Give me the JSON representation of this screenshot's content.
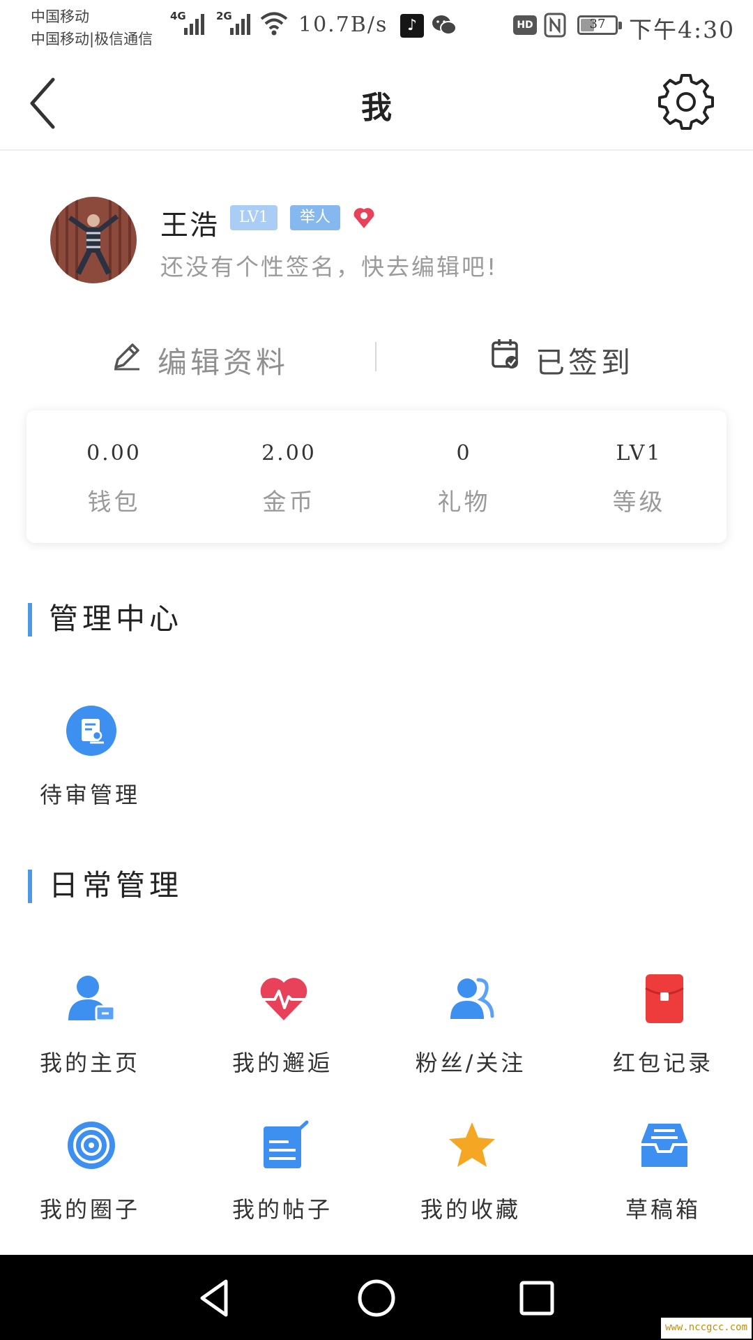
{
  "status_bar": {
    "carrier_1": "中国移动",
    "carrier_2": "中国移动|极信通信",
    "network_1": "4G",
    "network_2": "2G",
    "speed": "10.7B/s",
    "battery": "37",
    "battery_level": 0.37,
    "time": "下午4:30"
  },
  "header": {
    "title": "我"
  },
  "profile": {
    "name": "王浩",
    "level_badge": "LV1",
    "role_badge": "举人",
    "signature": "还没有个性签名，快去编辑吧!"
  },
  "actions": {
    "edit_profile": "编辑资料",
    "checked_in": "已签到"
  },
  "stats": [
    {
      "value": "0.00",
      "label": "钱包"
    },
    {
      "value": "2.00",
      "label": "金币"
    },
    {
      "value": "0",
      "label": "礼物"
    },
    {
      "value": "LV1",
      "label": "等级"
    }
  ],
  "management": {
    "title": "管理中心",
    "items": [
      {
        "label": "待审管理",
        "icon": "review-document-icon"
      }
    ]
  },
  "daily": {
    "title": "日常管理",
    "items": [
      {
        "label": "我的主页",
        "icon": "user-homepage-icon"
      },
      {
        "label": "我的邂逅",
        "icon": "heartbeat-icon"
      },
      {
        "label": "粉丝/关注",
        "icon": "followers-icon"
      },
      {
        "label": "红包记录",
        "icon": "red-envelope-icon"
      },
      {
        "label": "我的圈子",
        "icon": "circle-target-icon"
      },
      {
        "label": "我的帖子",
        "icon": "post-edit-icon"
      },
      {
        "label": "我的收藏",
        "icon": "star-icon"
      },
      {
        "label": "草稿箱",
        "icon": "drafts-inbox-icon"
      }
    ]
  },
  "colors": {
    "accent": "#4e98e6",
    "badge_level": "#a9cdf4",
    "badge_role": "#86b8f0",
    "heart": "#e8415a",
    "red_envelope": "#ee3b3b",
    "star": "#f5a623"
  },
  "watermark": "www.nccgcc.com"
}
